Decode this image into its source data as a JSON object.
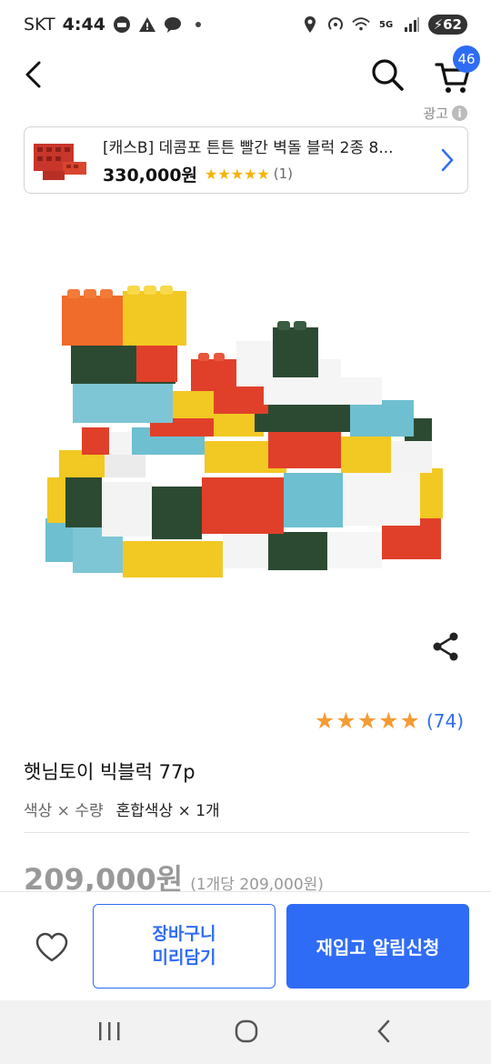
{
  "status_bar": {
    "carrier": "SKT",
    "time": "4:44",
    "battery": "62",
    "icons": [
      "car-icon",
      "warning-icon",
      "talk-icon",
      "dot-icon",
      "location-icon",
      "hotspot-icon",
      "wifi-icon",
      "5g-icon",
      "signal-icon",
      "battery-icon"
    ]
  },
  "header": {
    "cart_count": "46",
    "icons": [
      "back-arrow-icon",
      "search-icon",
      "cart-icon"
    ]
  },
  "ad": {
    "label": "광고",
    "title": "[캐스B] 데콤포 튼튼 빨간 벽돌 블럭 2종 8...",
    "price": "330,000원",
    "stars": "★★★★★",
    "review_count": "(1)"
  },
  "product": {
    "rating_stars": "★★★★★",
    "review_count": "(74)",
    "title": "햇님토이 빅블럭 77p",
    "option_label": "색상 × 수량",
    "option_value": "혼합색상 × 1개",
    "price": "209,000원",
    "unit_price": "(1개당 209,000원)"
  },
  "bottom_bar": {
    "cart_line1": "장바구니",
    "cart_line2": "미리담기",
    "restock": "재입고 알림신청"
  },
  "colors": {
    "accent": "#2f6cf6",
    "star": "#f39c34",
    "muted_price": "#999999"
  }
}
